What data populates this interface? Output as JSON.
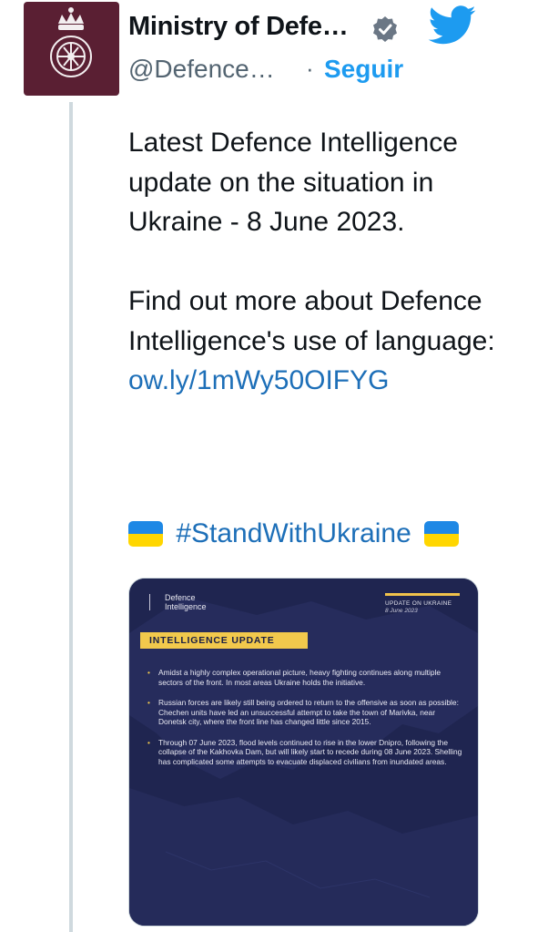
{
  "account": {
    "name": "Ministry of Defe…",
    "handle": "@Defence…",
    "follow_separator": "·",
    "follow_label": "Seguir",
    "verified_icon": "verified-badge-icon",
    "brand_icon": "twitter-bird-icon",
    "avatar_bg": "#5a1f33"
  },
  "tweet": {
    "paragraph1": "Latest Defence Intelligence update on the situation in Ukraine - 8 June 2023.",
    "paragraph2": "Find out more about Defence Intelligence's use of language:",
    "link": "ow.ly/1mWy50OIFYG",
    "hashtag": "#StandWithUkraine",
    "link_color": "#1d6fb8"
  },
  "card": {
    "logo_line1": "Defence",
    "logo_line2": "Intelligence",
    "update_label": "UPDATE ON UKRAINE",
    "update_date": "8 June 2023",
    "section_label": "INTELLIGENCE UPDATE",
    "bullets": [
      "Amidst a highly complex operational picture, heavy fighting continues along multiple sectors of the front. In most areas Ukraine holds the initiative.",
      "Russian forces are likely still being ordered to return to the offensive as soon as possible: Chechen units have led an unsuccessful attempt to take the town of Marivka, near Donetsk city, where the front line has changed little since 2015.",
      "Through 07 June 2023, flood levels continued to rise in the lower Dnipro, following the collapse of the Kakhovka Dam, but will likely start to recede during 08 June 2023. Shelling has complicated some attempts to evacuate displaced civilians from inundated areas."
    ],
    "bg_color": "#1f2550",
    "accent_color": "#f2c94c"
  }
}
